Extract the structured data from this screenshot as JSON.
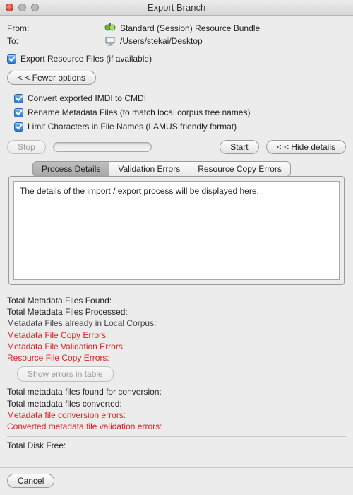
{
  "window": {
    "title": "Export Branch"
  },
  "header": {
    "from_label": "From:",
    "to_label": "To:",
    "from_value": "Standard (Session) Resource Bundle",
    "to_value": "/Users/stekai/Desktop"
  },
  "export_files": {
    "label": "Export Resource Files (if available)"
  },
  "fewer_options_label": "< < Fewer options",
  "options": {
    "convert_cmdi": "Convert exported IMDI to CMDI",
    "rename_metadata": "Rename Metadata Files (to match local corpus tree names)",
    "limit_chars": "Limit Characters in File Names (LAMUS friendly format)"
  },
  "actions": {
    "stop": "Stop",
    "start": "Start",
    "hide_details": "< < Hide details"
  },
  "tabs": {
    "process": "Process Details",
    "validation": "Validation Errors",
    "resource_copy": "Resource Copy Errors"
  },
  "details_placeholder": "The details of the import / export process will be displayed here.",
  "stats": {
    "total_found": "Total Metadata Files Found:",
    "total_processed": "Total Metadata Files Processed:",
    "already_in_corpus": "Metadata Files already in Local Corpus:",
    "copy_errors": "Metadata File Copy Errors:",
    "validation_errors": "Metadata File Validation Errors:",
    "resource_copy_errors": "Resource File Copy Errors:",
    "show_errors": "Show errors in table",
    "conversion_found": "Total metadata files found for conversion:",
    "conversion_converted": "Total metadata files converted:",
    "conversion_errors": "Metadata file conversion errors:",
    "converted_validation_errors": "Converted metadata file validation errors:",
    "disk_free": "Total Disk Free:"
  },
  "footer": {
    "cancel": "Cancel"
  }
}
